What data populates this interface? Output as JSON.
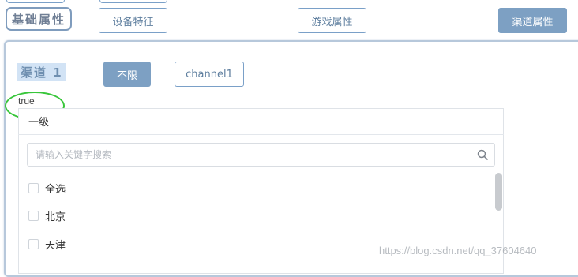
{
  "header": {
    "basic_title": "基础属性",
    "tabs": [
      {
        "label": "设备特征",
        "active": false
      },
      {
        "label": "游戏属性",
        "active": false
      },
      {
        "label": "渠道属性",
        "active": true
      }
    ]
  },
  "channel": {
    "label": "渠道 1",
    "options": [
      {
        "label": "不限",
        "selected": true
      },
      {
        "label": "channel1",
        "selected": false
      }
    ],
    "debug_value": "true"
  },
  "dropdown": {
    "level_title": "一级",
    "search_placeholder": "请输入关键字搜索",
    "items": [
      {
        "label": "全选",
        "checked": false
      },
      {
        "label": "北京",
        "checked": false
      },
      {
        "label": "天津",
        "checked": false
      }
    ]
  },
  "watermark": "https://blog.csdn.net/qq_37604640",
  "colors": {
    "accent": "#7da0c3",
    "border": "#7aa0c8",
    "highlight_bg": "#d2e3f5",
    "annotation_green": "#38c63a"
  }
}
